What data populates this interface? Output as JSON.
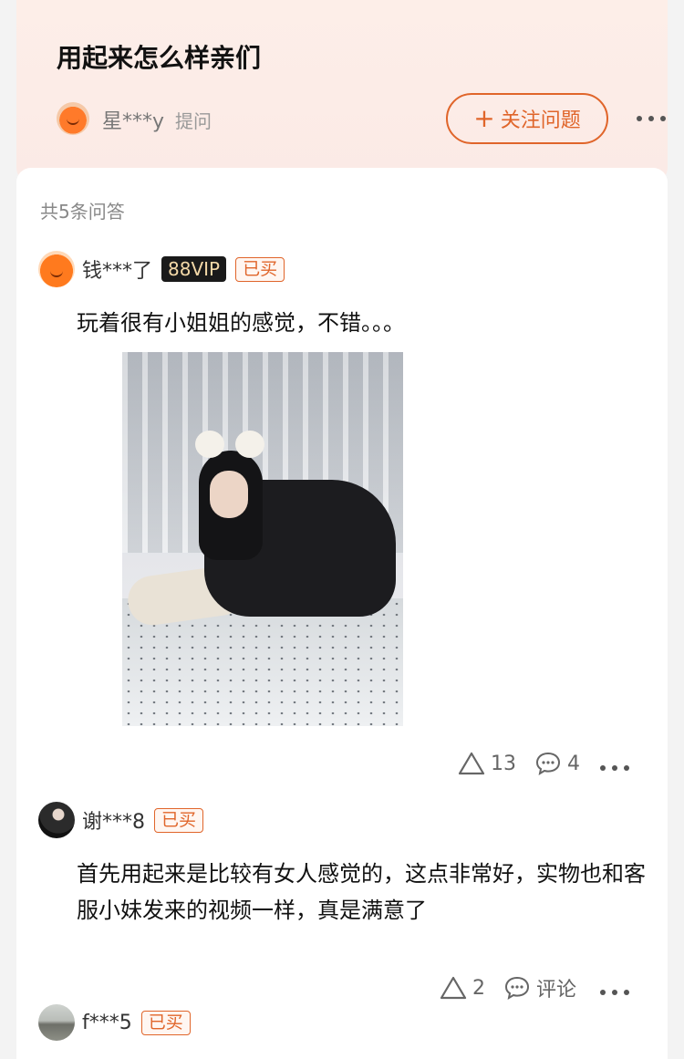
{
  "question": {
    "title": "用起来怎么样亲们",
    "asker_name": "星***y",
    "asker_action": "提问",
    "follow_label": "关注问题",
    "follow_icon": "plus-icon",
    "more_icon": "more-dots-icon"
  },
  "answers_header": {
    "count_label": "共5条问答"
  },
  "answers": [
    {
      "username": "钱***了",
      "vip_badge": "88VIP",
      "bought_badge": "已买",
      "text": "玩着很有小姐姐的感觉，不错。。。",
      "like_count": "13",
      "comment_count": "4",
      "avatar": "orange-mascot-avatar"
    },
    {
      "username": "谢***8",
      "bought_badge": "已买",
      "text": "首先用起来是比较有女人感觉的，这点非常好，实物也和客服小妹发来的视频一样，真是满意了",
      "like_count": "2",
      "comment_label": "评论",
      "avatar": "dark-photo-avatar"
    },
    {
      "username": "f***5",
      "bought_badge": "已买",
      "avatar": "landscape-photo-avatar"
    }
  ],
  "colors": {
    "accent": "#e0652a",
    "header_bg": "#fdeee8",
    "page_bg": "#f3f3f3"
  }
}
